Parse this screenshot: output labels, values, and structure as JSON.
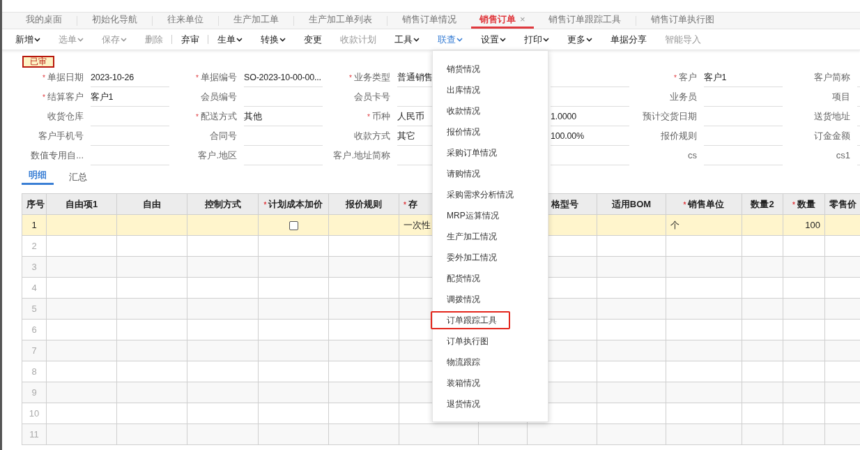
{
  "tabs": [
    {
      "label": "我的桌面",
      "selected": false
    },
    {
      "label": "初始化导航",
      "selected": false
    },
    {
      "label": "往来单位",
      "selected": false
    },
    {
      "label": "生产加工单",
      "selected": false
    },
    {
      "label": "生产加工单列表",
      "selected": false
    },
    {
      "label": "销售订单情况",
      "selected": false
    },
    {
      "label": "销售订单",
      "selected": true,
      "close": "×"
    },
    {
      "label": "销售订单跟踪工具",
      "selected": false
    },
    {
      "label": "销售订单执行图",
      "selected": false
    }
  ],
  "toolbar": [
    {
      "label": "新增",
      "caret": true,
      "disabled": false,
      "open": false
    },
    {
      "label": "选单",
      "caret": true,
      "disabled": true,
      "open": false
    },
    {
      "label": "保存",
      "caret": true,
      "disabled": true,
      "open": false
    },
    {
      "label": "删除",
      "caret": false,
      "disabled": true,
      "open": false,
      "separator_after": true
    },
    {
      "label": "弃审",
      "caret": false,
      "disabled": false,
      "open": false,
      "separator_after": true
    },
    {
      "label": "生单",
      "caret": true,
      "disabled": false,
      "open": false
    },
    {
      "label": "转换",
      "caret": true,
      "disabled": false,
      "open": false
    },
    {
      "label": "变更",
      "caret": false,
      "disabled": false,
      "open": false
    },
    {
      "label": "收款计划",
      "caret": false,
      "disabled": true,
      "open": false
    },
    {
      "label": "工具",
      "caret": true,
      "disabled": false,
      "open": false
    },
    {
      "label": "联查",
      "caret": true,
      "disabled": false,
      "open": true
    },
    {
      "label": "设置",
      "caret": true,
      "disabled": false,
      "open": false
    },
    {
      "label": "打印",
      "caret": true,
      "disabled": false,
      "open": false
    },
    {
      "label": "更多",
      "caret": true,
      "disabled": false,
      "open": false
    },
    {
      "label": "单据分享",
      "caret": false,
      "disabled": false,
      "open": false
    },
    {
      "label": "智能导入",
      "caret": false,
      "disabled": true,
      "open": false
    }
  ],
  "status_badge": "已审",
  "form": {
    "rows": [
      {
        "fields": [
          {
            "mark": "*",
            "label": "单据日期",
            "value": "2023-10-26"
          },
          {
            "mark": "*",
            "label": "单据编号",
            "value": "SO-2023-10-00-00..."
          },
          {
            "mark": "*",
            "label": "业务类型",
            "value": "普通销售"
          },
          {
            "kind": "blank_input"
          },
          {
            "mark": "*",
            "label": "客户",
            "value": "客户1"
          },
          {
            "label": "客户简称"
          }
        ]
      },
      {
        "fields": [
          {
            "mark": "*",
            "label": "结算客户",
            "value": "客户1"
          },
          {
            "label": "会员编号"
          },
          {
            "label": "会员卡号"
          },
          {
            "kind": "blank_input"
          },
          {
            "label": "业务员"
          },
          {
            "label": "项目"
          }
        ]
      },
      {
        "fields": [
          {
            "label": "收货仓库"
          },
          {
            "mark": "*",
            "label": "配送方式",
            "value": "其他"
          },
          {
            "mark": "*",
            "label": "币种",
            "value": "人民币"
          },
          {
            "value": "1.0000"
          },
          {
            "label": "预计交货日期"
          },
          {
            "label": "送货地址"
          }
        ]
      },
      {
        "fields": [
          {
            "label": "客户手机号"
          },
          {
            "label": "合同号"
          },
          {
            "label": "收款方式",
            "value": "其它"
          },
          {
            "value": "100.00%"
          },
          {
            "label": "报价规则"
          },
          {
            "label": "订金金额"
          }
        ]
      },
      {
        "fields": [
          {
            "label": "数值专用自..."
          },
          {
            "label": "客户.地区"
          },
          {
            "label": "客户.地址简称"
          },
          {
            "kind": "blank_input"
          },
          {
            "label": "cs"
          },
          {
            "label": "cs1"
          }
        ]
      }
    ]
  },
  "detail_tabs": [
    {
      "label": "明细",
      "selected": true
    },
    {
      "label": "汇总",
      "selected": false
    }
  ],
  "table": {
    "columns": [
      {
        "label": "序号"
      },
      {
        "label": "自由项1"
      },
      {
        "label": "自由"
      },
      {
        "label": "控制方式"
      },
      {
        "mark": "*",
        "label": "计划成本加价"
      },
      {
        "label": "报价规则"
      },
      {
        "mark": "*",
        "label": "存"
      },
      {
        "label": "格型号"
      },
      {
        "label": "适用BOM"
      },
      {
        "mark": "*",
        "label": "销售单位"
      },
      {
        "label": "数量2"
      },
      {
        "mark": "*",
        "label": "数量",
        "numeric": true
      },
      {
        "label": "零售价"
      }
    ],
    "rows": [
      {
        "selected": true,
        "cells": [
          {
            "value": "1"
          },
          {},
          {},
          {},
          {
            "kind": "checkbox",
            "checked": false
          },
          {},
          {
            "value": "一次性"
          },
          {},
          {},
          {
            "value": "个"
          },
          {},
          {
            "value": "100"
          },
          {}
        ]
      },
      {
        "selected": false,
        "cells": [
          {
            "value": "2"
          }
        ]
      },
      {
        "selected": false,
        "cells": [
          {
            "value": "3"
          }
        ]
      },
      {
        "selected": false,
        "cells": [
          {
            "value": "4"
          }
        ]
      },
      {
        "selected": false,
        "cells": [
          {
            "value": "5"
          }
        ]
      },
      {
        "selected": false,
        "cells": [
          {
            "value": "6"
          }
        ]
      },
      {
        "selected": false,
        "cells": [
          {
            "value": "7"
          }
        ]
      },
      {
        "selected": false,
        "cells": [
          {
            "value": "8"
          }
        ]
      },
      {
        "selected": false,
        "cells": [
          {
            "value": "9"
          }
        ]
      },
      {
        "selected": false,
        "cells": [
          {
            "value": "10"
          }
        ]
      },
      {
        "selected": false,
        "cells": [
          {
            "value": "11"
          }
        ]
      }
    ]
  },
  "dropdown_menu": [
    {
      "label": "销货情况",
      "highlighted": false
    },
    {
      "label": "出库情况",
      "highlighted": false
    },
    {
      "label": "收款情况",
      "highlighted": false
    },
    {
      "label": "报价情况",
      "highlighted": false
    },
    {
      "label": "采购订单情况",
      "highlighted": false
    },
    {
      "label": "请购情况",
      "highlighted": false
    },
    {
      "label": "采购需求分析情况",
      "highlighted": false
    },
    {
      "label": "MRP运算情况",
      "highlighted": false
    },
    {
      "label": "生产加工情况",
      "highlighted": false
    },
    {
      "label": "委外加工情况",
      "highlighted": false
    },
    {
      "label": "配货情况",
      "highlighted": false
    },
    {
      "label": "调拨情况",
      "highlighted": false
    },
    {
      "label": "订单跟踪工具",
      "highlighted": true
    },
    {
      "label": "订单执行图",
      "highlighted": false
    },
    {
      "label": "物流跟踪",
      "highlighted": false
    },
    {
      "label": "装箱情况",
      "highlighted": false
    },
    {
      "label": "退货情况",
      "highlighted": false
    }
  ]
}
